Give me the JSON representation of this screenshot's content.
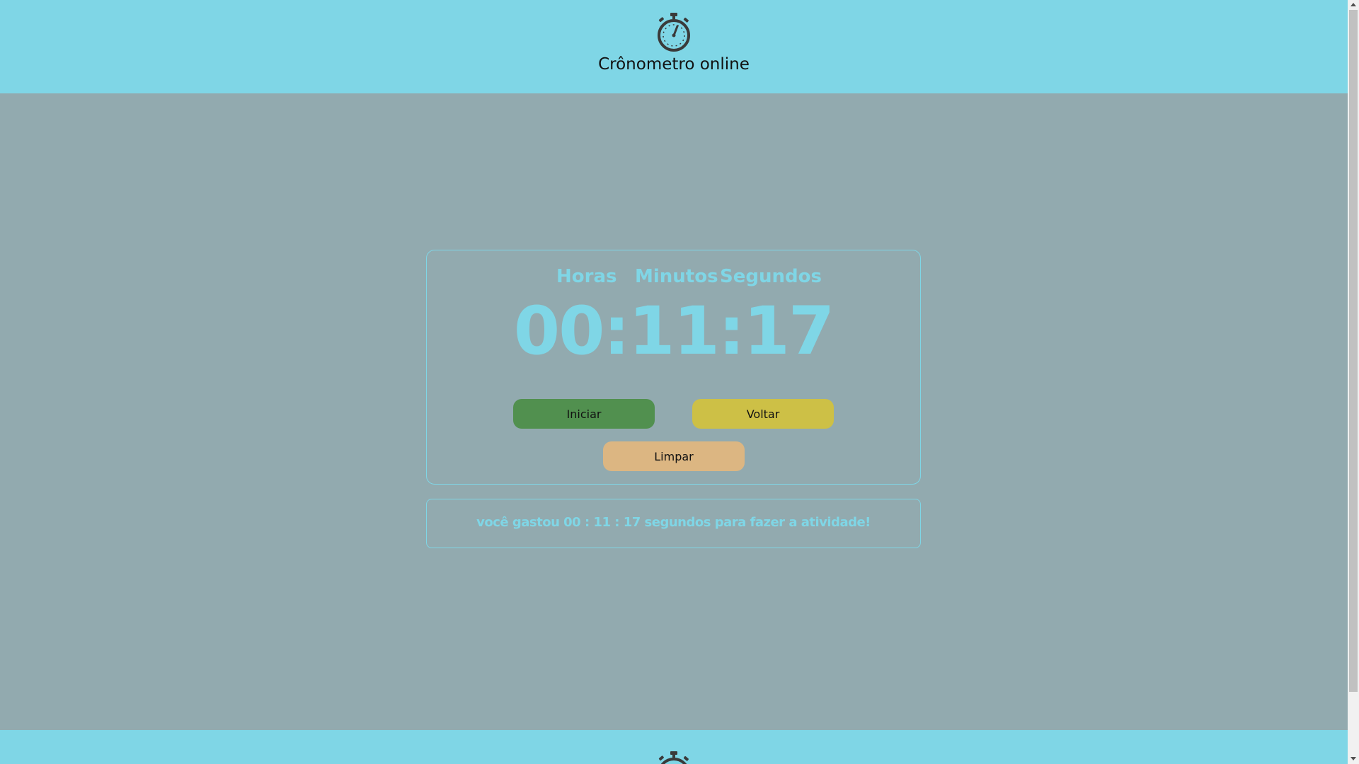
{
  "header": {
    "icon": "stopwatch-icon",
    "title": "Crônometro online"
  },
  "timer": {
    "labels": {
      "hours": "Horas",
      "minutes": "Minutos",
      "seconds": "Segundos"
    },
    "display": "00:11:17",
    "buttons": {
      "start": "Iniciar",
      "back": "Voltar",
      "clear": "Limpar"
    }
  },
  "result": {
    "message": "você gastou 00 : 11 : 17 segundos para fazer a atividade!"
  },
  "footer": {
    "icon": "stopwatch-icon"
  },
  "colors": {
    "accent": "#7fd6e6",
    "background": "#92aaaf",
    "start_button": "#51904f",
    "back_button": "#cdc046",
    "clear_button": "#dcb682"
  }
}
